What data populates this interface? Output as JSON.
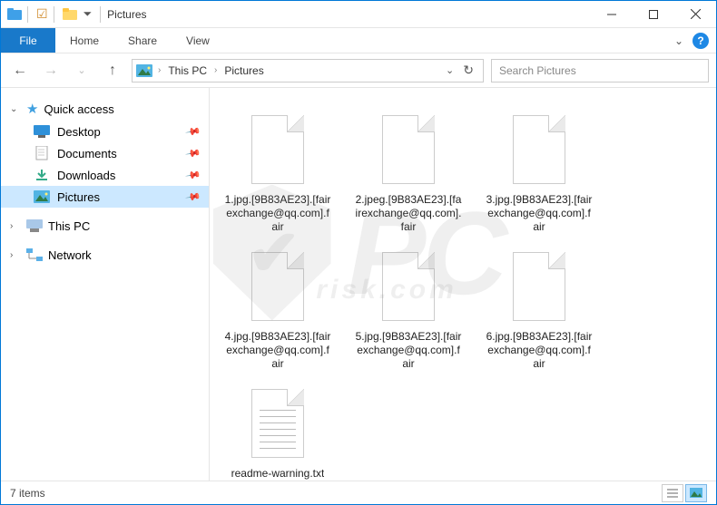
{
  "title": "Pictures",
  "ribbon": {
    "file": "File",
    "tabs": [
      "Home",
      "Share",
      "View"
    ]
  },
  "breadcrumb": {
    "items": [
      "This PC",
      "Pictures"
    ]
  },
  "search": {
    "placeholder": "Search Pictures"
  },
  "sidebar": {
    "quick_access": {
      "label": "Quick access",
      "items": [
        {
          "label": "Desktop",
          "icon": "desktop"
        },
        {
          "label": "Documents",
          "icon": "documents"
        },
        {
          "label": "Downloads",
          "icon": "downloads"
        },
        {
          "label": "Pictures",
          "icon": "pictures",
          "selected": true
        }
      ]
    },
    "this_pc": {
      "label": "This PC"
    },
    "network": {
      "label": "Network"
    }
  },
  "files": [
    {
      "name": "1.jpg.[9B83AE23].[fairexchange@qq.com].fair",
      "type": "blank"
    },
    {
      "name": "2.jpeg.[9B83AE23].[fairexchange@qq.com].fair",
      "type": "blank"
    },
    {
      "name": "3.jpg.[9B83AE23].[fairexchange@qq.com].fair",
      "type": "blank"
    },
    {
      "name": "4.jpg.[9B83AE23].[fairexchange@qq.com].fair",
      "type": "blank"
    },
    {
      "name": "5.jpg.[9B83AE23].[fairexchange@qq.com].fair",
      "type": "blank"
    },
    {
      "name": "6.jpg.[9B83AE23].[fairexchange@qq.com].fair",
      "type": "blank"
    },
    {
      "name": "readme-warning.txt",
      "type": "txt"
    }
  ],
  "status": {
    "count_label": "7 items"
  },
  "watermark": {
    "brand": "PC",
    "sub": "risk.com"
  }
}
